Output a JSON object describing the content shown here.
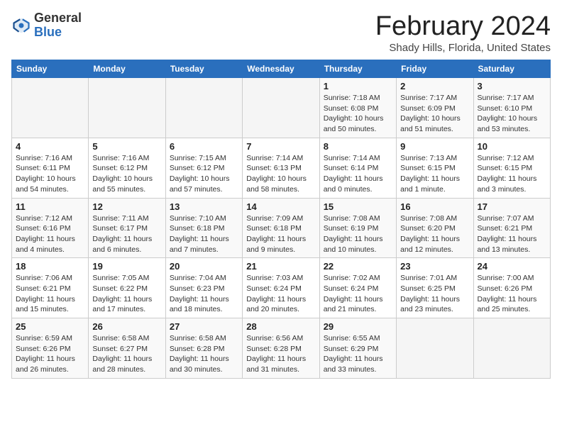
{
  "header": {
    "logo_general": "General",
    "logo_blue": "Blue",
    "month_title": "February 2024",
    "location": "Shady Hills, Florida, United States"
  },
  "days_of_week": [
    "Sunday",
    "Monday",
    "Tuesday",
    "Wednesday",
    "Thursday",
    "Friday",
    "Saturday"
  ],
  "weeks": [
    [
      {
        "day": "",
        "detail": ""
      },
      {
        "day": "",
        "detail": ""
      },
      {
        "day": "",
        "detail": ""
      },
      {
        "day": "",
        "detail": ""
      },
      {
        "day": "1",
        "detail": "Sunrise: 7:18 AM\nSunset: 6:08 PM\nDaylight: 10 hours\nand 50 minutes."
      },
      {
        "day": "2",
        "detail": "Sunrise: 7:17 AM\nSunset: 6:09 PM\nDaylight: 10 hours\nand 51 minutes."
      },
      {
        "day": "3",
        "detail": "Sunrise: 7:17 AM\nSunset: 6:10 PM\nDaylight: 10 hours\nand 53 minutes."
      }
    ],
    [
      {
        "day": "4",
        "detail": "Sunrise: 7:16 AM\nSunset: 6:11 PM\nDaylight: 10 hours\nand 54 minutes."
      },
      {
        "day": "5",
        "detail": "Sunrise: 7:16 AM\nSunset: 6:12 PM\nDaylight: 10 hours\nand 55 minutes."
      },
      {
        "day": "6",
        "detail": "Sunrise: 7:15 AM\nSunset: 6:12 PM\nDaylight: 10 hours\nand 57 minutes."
      },
      {
        "day": "7",
        "detail": "Sunrise: 7:14 AM\nSunset: 6:13 PM\nDaylight: 10 hours\nand 58 minutes."
      },
      {
        "day": "8",
        "detail": "Sunrise: 7:14 AM\nSunset: 6:14 PM\nDaylight: 11 hours\nand 0 minutes."
      },
      {
        "day": "9",
        "detail": "Sunrise: 7:13 AM\nSunset: 6:15 PM\nDaylight: 11 hours\nand 1 minute."
      },
      {
        "day": "10",
        "detail": "Sunrise: 7:12 AM\nSunset: 6:15 PM\nDaylight: 11 hours\nand 3 minutes."
      }
    ],
    [
      {
        "day": "11",
        "detail": "Sunrise: 7:12 AM\nSunset: 6:16 PM\nDaylight: 11 hours\nand 4 minutes."
      },
      {
        "day": "12",
        "detail": "Sunrise: 7:11 AM\nSunset: 6:17 PM\nDaylight: 11 hours\nand 6 minutes."
      },
      {
        "day": "13",
        "detail": "Sunrise: 7:10 AM\nSunset: 6:18 PM\nDaylight: 11 hours\nand 7 minutes."
      },
      {
        "day": "14",
        "detail": "Sunrise: 7:09 AM\nSunset: 6:18 PM\nDaylight: 11 hours\nand 9 minutes."
      },
      {
        "day": "15",
        "detail": "Sunrise: 7:08 AM\nSunset: 6:19 PM\nDaylight: 11 hours\nand 10 minutes."
      },
      {
        "day": "16",
        "detail": "Sunrise: 7:08 AM\nSunset: 6:20 PM\nDaylight: 11 hours\nand 12 minutes."
      },
      {
        "day": "17",
        "detail": "Sunrise: 7:07 AM\nSunset: 6:21 PM\nDaylight: 11 hours\nand 13 minutes."
      }
    ],
    [
      {
        "day": "18",
        "detail": "Sunrise: 7:06 AM\nSunset: 6:21 PM\nDaylight: 11 hours\nand 15 minutes."
      },
      {
        "day": "19",
        "detail": "Sunrise: 7:05 AM\nSunset: 6:22 PM\nDaylight: 11 hours\nand 17 minutes."
      },
      {
        "day": "20",
        "detail": "Sunrise: 7:04 AM\nSunset: 6:23 PM\nDaylight: 11 hours\nand 18 minutes."
      },
      {
        "day": "21",
        "detail": "Sunrise: 7:03 AM\nSunset: 6:24 PM\nDaylight: 11 hours\nand 20 minutes."
      },
      {
        "day": "22",
        "detail": "Sunrise: 7:02 AM\nSunset: 6:24 PM\nDaylight: 11 hours\nand 21 minutes."
      },
      {
        "day": "23",
        "detail": "Sunrise: 7:01 AM\nSunset: 6:25 PM\nDaylight: 11 hours\nand 23 minutes."
      },
      {
        "day": "24",
        "detail": "Sunrise: 7:00 AM\nSunset: 6:26 PM\nDaylight: 11 hours\nand 25 minutes."
      }
    ],
    [
      {
        "day": "25",
        "detail": "Sunrise: 6:59 AM\nSunset: 6:26 PM\nDaylight: 11 hours\nand 26 minutes."
      },
      {
        "day": "26",
        "detail": "Sunrise: 6:58 AM\nSunset: 6:27 PM\nDaylight: 11 hours\nand 28 minutes."
      },
      {
        "day": "27",
        "detail": "Sunrise: 6:58 AM\nSunset: 6:28 PM\nDaylight: 11 hours\nand 30 minutes."
      },
      {
        "day": "28",
        "detail": "Sunrise: 6:56 AM\nSunset: 6:28 PM\nDaylight: 11 hours\nand 31 minutes."
      },
      {
        "day": "29",
        "detail": "Sunrise: 6:55 AM\nSunset: 6:29 PM\nDaylight: 11 hours\nand 33 minutes."
      },
      {
        "day": "",
        "detail": ""
      },
      {
        "day": "",
        "detail": ""
      }
    ]
  ]
}
